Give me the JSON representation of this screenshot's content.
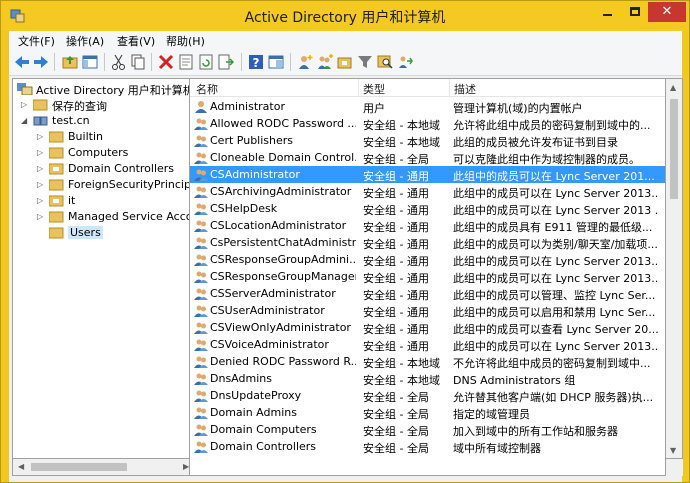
{
  "window": {
    "title": "Active Directory 用户和计算机",
    "close_glyph": "✕"
  },
  "menu": [
    {
      "label": "文件(F)"
    },
    {
      "label": "操作(A)"
    },
    {
      "label": "查看(V)"
    },
    {
      "label": "帮助(H)"
    }
  ],
  "toolbar": {
    "icons": [
      "back-icon",
      "forward-icon",
      "up-folder-icon",
      "show-tree-icon",
      "cut-icon",
      "copy-icon",
      "delete-icon",
      "properties-icon",
      "refresh-icon",
      "export-list-icon",
      "help-icon",
      "console-icon",
      "new-user-icon",
      "new-group-icon",
      "new-ou-icon",
      "filter-icon",
      "find-icon",
      "add-to-group-icon"
    ]
  },
  "tree": {
    "root": "Active Directory 用户和计算机",
    "saved_queries": "保存的查询",
    "domain": "test.cn",
    "children": [
      {
        "label": "Builtin"
      },
      {
        "label": "Computers"
      },
      {
        "label": "Domain Controllers"
      },
      {
        "label": "ForeignSecurityPrincipals"
      },
      {
        "label": "it"
      },
      {
        "label": "Managed Service Accounts"
      },
      {
        "label": "Users"
      }
    ]
  },
  "columns": {
    "name": "名称",
    "type": "类型",
    "description": "描述"
  },
  "rows": [
    {
      "name": "Administrator",
      "type": "用户",
      "description": "管理计算机(域)的内置帐户",
      "icon": "user-icon"
    },
    {
      "name": "Allowed RODC Password ...",
      "type": "安全组 - 本地域",
      "description": "允许将此组中成员的密码复制到域中的...",
      "icon": "group-icon"
    },
    {
      "name": "Cert Publishers",
      "type": "安全组 - 本地域",
      "description": "此组的成员被允许发布证书到目录",
      "icon": "group-icon"
    },
    {
      "name": "Cloneable Domain Control...",
      "type": "安全组 - 全局",
      "description": "可以克隆此组中作为域控制器的成员。",
      "icon": "group-icon"
    },
    {
      "name": "CSAdministrator",
      "type": "安全组 - 通用",
      "description": "此组中的成员可以在 Lync Server 201...",
      "icon": "group-icon",
      "selected": true
    },
    {
      "name": "CSArchivingAdministrator",
      "type": "安全组 - 通用",
      "description": "此组中的成员可以在 Lync Server 2013...",
      "icon": "group-icon"
    },
    {
      "name": "CSHelpDesk",
      "type": "安全组 - 通用",
      "description": "此组中的成员可以在 Lync Server 2013 ...",
      "icon": "group-icon"
    },
    {
      "name": "CSLocationAdministrator",
      "type": "安全组 - 通用",
      "description": "此组中的成员具有 E911 管理的最低级...",
      "icon": "group-icon"
    },
    {
      "name": "CsPersistentChatAdministr...",
      "type": "安全组 - 通用",
      "description": "此组中的成员可以为类别/聊天室/加载项...",
      "icon": "group-icon"
    },
    {
      "name": "CSResponseGroupAdmini...",
      "type": "安全组 - 通用",
      "description": "此组中的成员可以在 Lync Server 2013...",
      "icon": "group-icon"
    },
    {
      "name": "CSResponseGroupManager",
      "type": "安全组 - 通用",
      "description": "此组中的成员可以在 Lync Server 2013...",
      "icon": "group-icon"
    },
    {
      "name": "CSServerAdministrator",
      "type": "安全组 - 通用",
      "description": "此组中的成员可以管理、监控 Lync Ser...",
      "icon": "group-icon"
    },
    {
      "name": "CSUserAdministrator",
      "type": "安全组 - 通用",
      "description": "此组中的成员可以启用和禁用 Lync Ser...",
      "icon": "group-icon"
    },
    {
      "name": "CSViewOnlyAdministrator",
      "type": "安全组 - 通用",
      "description": "此组中的成员可以查看 Lync Server 20...",
      "icon": "group-icon"
    },
    {
      "name": "CSVoiceAdministrator",
      "type": "安全组 - 通用",
      "description": "此组中的成员可以在 Lync Server 2013...",
      "icon": "group-icon"
    },
    {
      "name": "Denied RODC Password R...",
      "type": "安全组 - 本地域",
      "description": "不允许将此组中成员的密码复制到域中...",
      "icon": "group-icon"
    },
    {
      "name": "DnsAdmins",
      "type": "安全组 - 本地域",
      "description": "DNS Administrators 组",
      "icon": "group-icon"
    },
    {
      "name": "DnsUpdateProxy",
      "type": "安全组 - 全局",
      "description": "允许替其他客户端(如 DHCP 服务器)执...",
      "icon": "group-icon"
    },
    {
      "name": "Domain Admins",
      "type": "安全组 - 全局",
      "description": "指定的域管理员",
      "icon": "group-icon"
    },
    {
      "name": "Domain Computers",
      "type": "安全组 - 全局",
      "description": "加入到域中的所有工作站和服务器",
      "icon": "group-icon"
    },
    {
      "name": "Domain Controllers",
      "type": "安全组 - 全局",
      "description": "域中所有域控制器",
      "icon": "group-icon"
    }
  ],
  "colors": {
    "title_bar": "#f4c922",
    "selection": "#3399ff",
    "close_button": "#c7372f"
  }
}
